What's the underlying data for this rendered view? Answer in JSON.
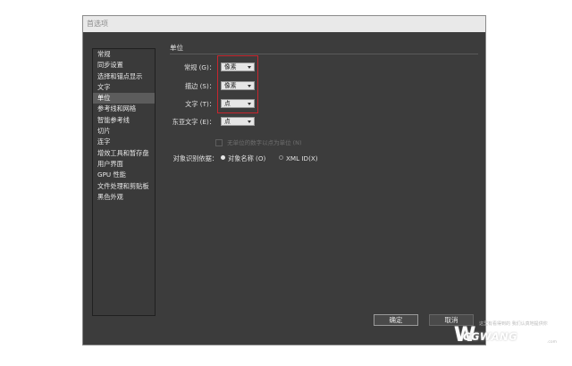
{
  "window": {
    "title": "首选项"
  },
  "sidebar": {
    "items": [
      {
        "label": "常规"
      },
      {
        "label": "同步设置"
      },
      {
        "label": "选择和锚点显示"
      },
      {
        "label": "文字"
      },
      {
        "label": "单位",
        "selected": true
      },
      {
        "label": "参考线和网格"
      },
      {
        "label": "智能参考线"
      },
      {
        "label": "切片"
      },
      {
        "label": "连字"
      },
      {
        "label": "增效工具和暂存盘"
      },
      {
        "label": "用户界面"
      },
      {
        "label": "GPU 性能"
      },
      {
        "label": "文件处理和剪贴板"
      },
      {
        "label": "黑色外观"
      }
    ]
  },
  "units": {
    "section_title": "单位",
    "rows": [
      {
        "label": "常规 (G)：",
        "value": "像素"
      },
      {
        "label": "描边 (S)：",
        "value": "像素"
      },
      {
        "label": "文字 (T)：",
        "value": "点"
      },
      {
        "label": "东亚文字 (E)：",
        "value": "点"
      }
    ],
    "checkbox_label": "无单位的数字以点为单位 (N)",
    "object_id": {
      "label": "对象识别依据：",
      "options": [
        {
          "label": "对象名称 (O)",
          "checked": true
        },
        {
          "label": "XML ID(X)",
          "checked": false
        }
      ]
    }
  },
  "footer": {
    "ok_label": "确定",
    "cancel_label": "取消"
  },
  "watermark": {
    "brand": "CGWANG",
    "tagline": "这里有看得到的  我们认真地提供你",
    "suffix": ".com"
  }
}
